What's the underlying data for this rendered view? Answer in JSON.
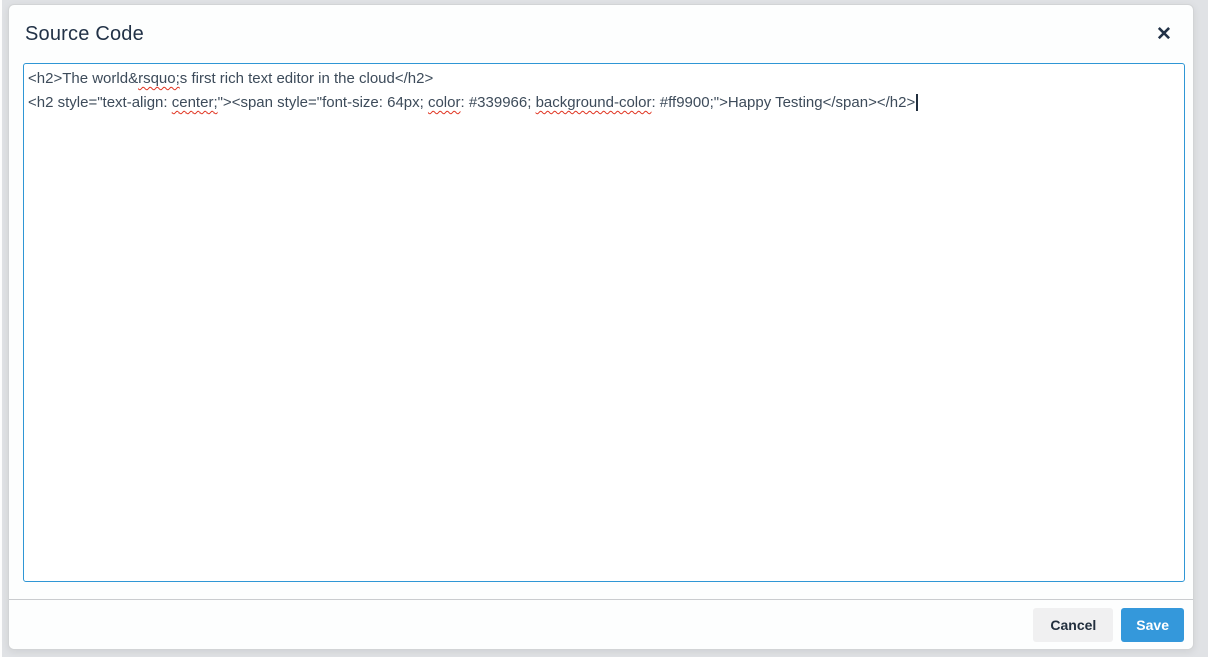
{
  "dialog": {
    "title": "Source Code",
    "close_icon": "✕"
  },
  "editor": {
    "lines": [
      {
        "segments": [
          {
            "text": "<h2>The world&"
          },
          {
            "text": "rsquo;",
            "misspelled": true
          },
          {
            "text": "s first rich text editor in the cloud</h2>"
          }
        ],
        "caret_at_end": false
      },
      {
        "segments": [
          {
            "text": "<h2 style=\"text-align: "
          },
          {
            "text": "center;",
            "misspelled": true
          },
          {
            "text": "\"><span style=\"font-size: 64px; "
          },
          {
            "text": "color",
            "misspelled": true
          },
          {
            "text": ": #339966; "
          },
          {
            "text": "background-color",
            "misspelled": true
          },
          {
            "text": ": #ff9900;\">Happy Testing</span></h2>"
          }
        ],
        "caret_at_end": true
      }
    ]
  },
  "footer": {
    "cancel_label": "Cancel",
    "save_label": "Save"
  },
  "colors": {
    "primary_button": "#3498db",
    "focus_border": "#2f96d5",
    "title_text": "#223247",
    "code_text": "#3d4b5a",
    "spellcheck": "#e0321f"
  }
}
